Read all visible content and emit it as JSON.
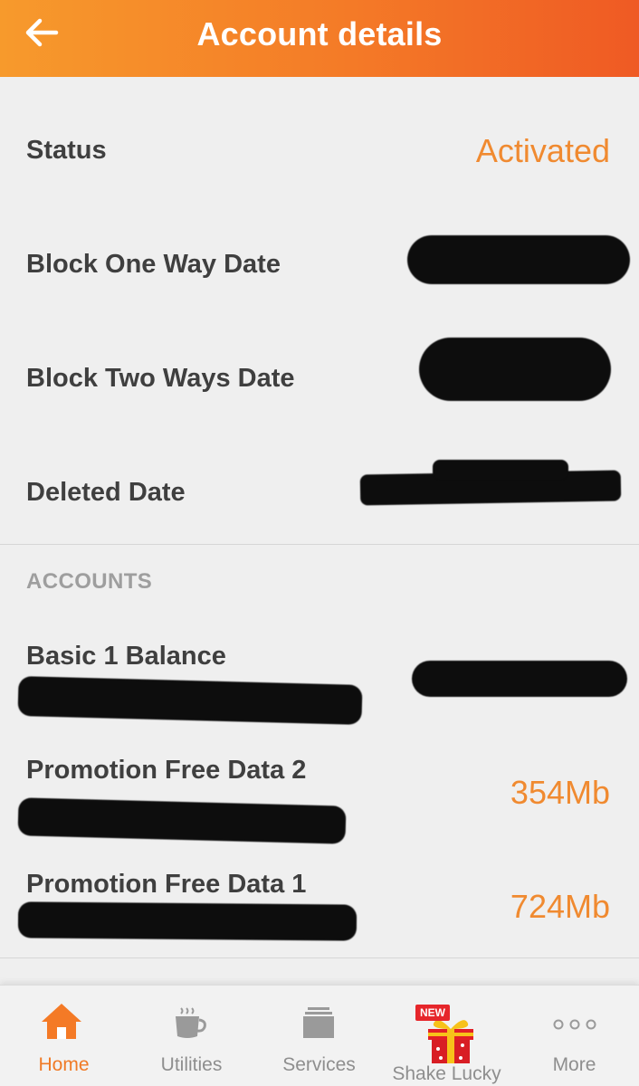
{
  "header": {
    "title": "Account details"
  },
  "details": [
    {
      "label": "Status",
      "value": "Activated"
    },
    {
      "label": "Block One Way Date"
    },
    {
      "label": "Block Two Ways Date"
    },
    {
      "label": "Deleted Date"
    }
  ],
  "accounts": {
    "section_title": "ACCOUNTS",
    "items": [
      {
        "label": "Basic 1 Balance"
      },
      {
        "label": "Promotion Free Data 2",
        "value": "354Mb"
      },
      {
        "label": "Promotion Free Data 1",
        "value": "724Mb"
      }
    ]
  },
  "bottom_nav": {
    "items": [
      {
        "label": "Home",
        "icon": "home-icon",
        "active": true
      },
      {
        "label": "Utilities",
        "icon": "cup-icon"
      },
      {
        "label": "Services",
        "icon": "layers-icon"
      },
      {
        "label": "Shake Lucky",
        "icon": "gift-icon",
        "badge": "NEW"
      },
      {
        "label": "More",
        "icon": "more-dots-icon"
      }
    ]
  },
  "colors": {
    "header_start": "#f79a2c",
    "header_end": "#ef5a24",
    "accent": "#f08a30",
    "active_nav": "#f07a26"
  }
}
